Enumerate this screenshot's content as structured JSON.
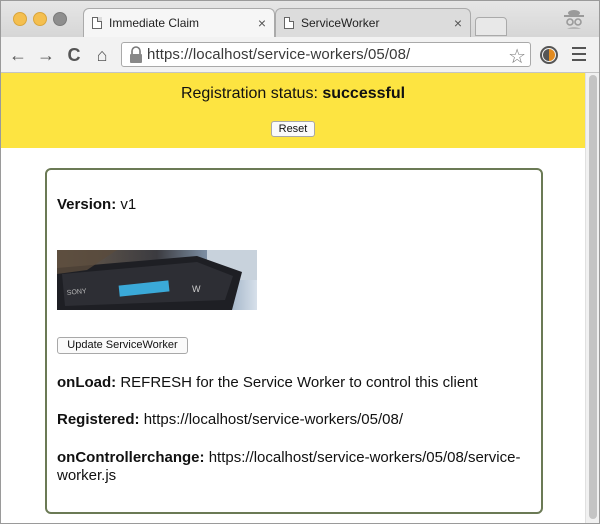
{
  "browser": {
    "tabs": [
      {
        "title": "Immediate Claim",
        "close": "×"
      },
      {
        "title": "ServiceWorker",
        "close": "×"
      }
    ],
    "url": "https://localhost/service-workers/05/08/",
    "star": "☆",
    "nav": {
      "back": "←",
      "forward": "→",
      "reload": "C",
      "home": "⌂"
    }
  },
  "status": {
    "label": "Registration status:",
    "value": "successful",
    "reset_button": "Reset",
    "banner_color": "#fde441"
  },
  "card": {
    "version_label": "Version:",
    "version_value": "v1",
    "update_button": "Update ServiceWorker",
    "onload_label": "onLoad:",
    "onload_value": "REFRESH for the Service Worker to control this client",
    "registered_label": "Registered:",
    "registered_value": "https://localhost/service-workers/05/08/",
    "controllerchange_label": "onControllerchange:",
    "controllerchange_value": "https://localhost/service-workers/05/08/service-worker.js",
    "border_color": "#6b7a55"
  },
  "icons": {
    "incognito": "incognito-icon",
    "lock": "lock-icon",
    "extension": "extension-icon",
    "menu": "menu-icon"
  }
}
